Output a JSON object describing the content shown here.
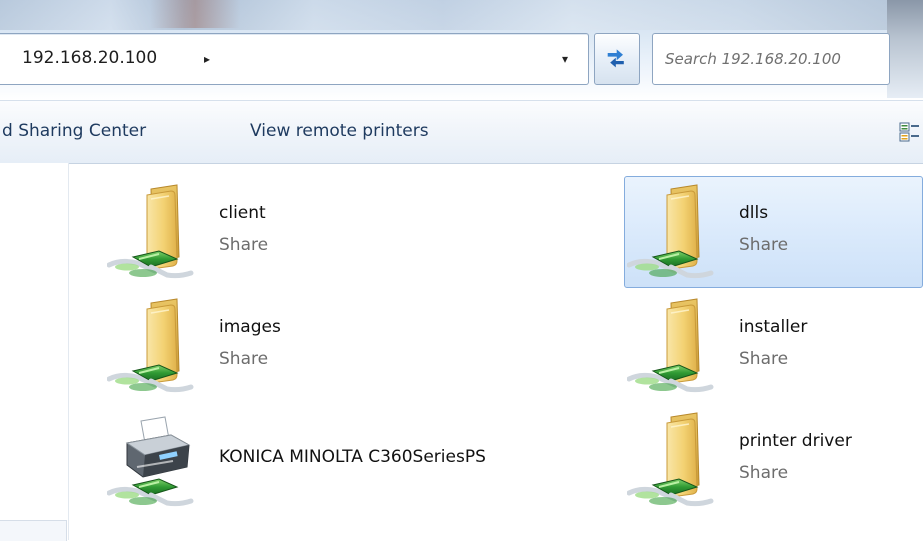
{
  "address_bar": {
    "path": "192.168.20.100",
    "breadcrumb_arrow": "▸",
    "dropdown_arrow": "▾"
  },
  "search": {
    "placeholder": "Search 192.168.20.100"
  },
  "command_bar": {
    "network_center": "d Sharing Center",
    "view_printers": "View remote printers"
  },
  "items": [
    {
      "name": "client",
      "type": "Share",
      "icon": "network-folder-icon",
      "selected": false
    },
    {
      "name": "dlls",
      "type": "Share",
      "icon": "network-folder-icon",
      "selected": true
    },
    {
      "name": "images",
      "type": "Share",
      "icon": "network-folder-icon",
      "selected": false
    },
    {
      "name": "installer",
      "type": "Share",
      "icon": "network-folder-icon",
      "selected": false
    },
    {
      "name": "KONICA MINOLTA C360SeriesPS",
      "type": "",
      "icon": "network-printer-icon",
      "selected": false
    },
    {
      "name": "printer driver",
      "type": "Share",
      "icon": "network-folder-icon",
      "selected": false
    }
  ],
  "colors": {
    "selection_border": "#84acdd",
    "selection_fill": "#d9e9fb",
    "folder": "#f2cf6b",
    "network_cable": "#3aa03c",
    "command_text": "#1e3a5f"
  }
}
